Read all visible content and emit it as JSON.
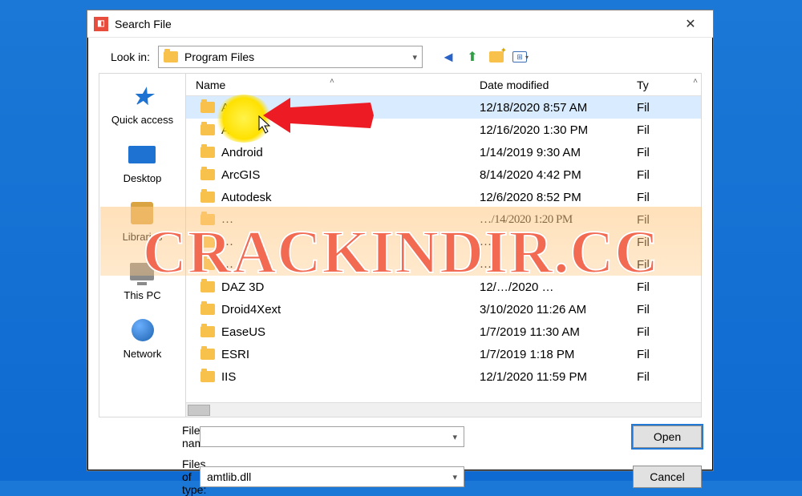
{
  "window": {
    "title": "Search File",
    "close_glyph": "✕"
  },
  "lookin": {
    "label": "Look in:",
    "value": "Program Files"
  },
  "toolbar_icons": {
    "back": "back-icon",
    "up": "up-one-level-icon",
    "newfolder": "new-folder-icon",
    "view": "view-menu-icon"
  },
  "places": [
    {
      "id": "quick-access",
      "label": "Quick access"
    },
    {
      "id": "desktop",
      "label": "Desktop"
    },
    {
      "id": "libraries",
      "label": "Libraries"
    },
    {
      "id": "this-pc",
      "label": "This PC"
    },
    {
      "id": "network",
      "label": "Network"
    }
  ],
  "columns": {
    "name": "Name",
    "date": "Date modified",
    "type": "Ty"
  },
  "rows": [
    {
      "name": "Adobe",
      "date": "12/18/2020 8:57 AM",
      "type": "Fil",
      "selected": true
    },
    {
      "name": "Altium",
      "date": "12/16/2020 1:30 PM",
      "type": "Fil"
    },
    {
      "name": "Android",
      "date": "1/14/2019 9:30 AM",
      "type": "Fil"
    },
    {
      "name": "ArcGIS",
      "date": "8/14/2020 4:42 PM",
      "type": "Fil"
    },
    {
      "name": "Autodesk",
      "date": "12/6/2020 8:52 PM",
      "type": "Fil"
    },
    {
      "name": "…",
      "date": "…/14/2020 1:20 PM",
      "type": "Fil",
      "obscured": true
    },
    {
      "name": "…",
      "date": "…",
      "type": "Fil",
      "obscured": true
    },
    {
      "name": "…",
      "date": "…",
      "type": "Fil",
      "obscured": true
    },
    {
      "name": "DAZ 3D",
      "date": "12/…/2020 …",
      "type": "Fil"
    },
    {
      "name": "Droid4Xext",
      "date": "3/10/2020 11:26 AM",
      "type": "Fil"
    },
    {
      "name": "EaseUS",
      "date": "1/7/2019 11:30 AM",
      "type": "Fil"
    },
    {
      "name": "ESRI",
      "date": "1/7/2019 1:18 PM",
      "type": "Fil"
    },
    {
      "name": "IIS",
      "date": "12/1/2020 11:59 PM",
      "type": "Fil"
    }
  ],
  "filename": {
    "label": "File name:",
    "value": ""
  },
  "filetype": {
    "label": "Files of type:",
    "value": "amtlib.dll"
  },
  "buttons": {
    "open": "Open",
    "cancel": "Cancel"
  },
  "watermark": "CRACKINDIR.CC"
}
